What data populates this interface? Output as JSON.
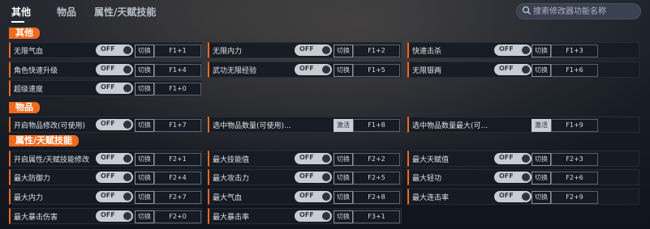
{
  "tabs": [
    "其他",
    "物品",
    "属性/天赋技能"
  ],
  "search": {
    "placeholder": "搜索修改器功能名称"
  },
  "sections": {
    "other": "其他",
    "items": "物品",
    "attrs": "属性/天赋技能"
  },
  "rows": [
    {
      "name": "无限气血",
      "toggle": "OFF",
      "action": "切换",
      "key": "F1+1"
    },
    {
      "name": "无限内力",
      "toggle": "OFF",
      "action": "切换",
      "key": "F1+2"
    },
    {
      "name": "快速击杀",
      "toggle": "OFF",
      "action": "切换",
      "key": "F1+3"
    },
    {
      "name": "角色快速升级",
      "toggle": "OFF",
      "action": "切换",
      "key": "F1+4"
    },
    {
      "name": "武功无限经验",
      "toggle": "OFF",
      "action": "切换",
      "key": "F1+5"
    },
    {
      "name": "无限银两",
      "toggle": "OFF",
      "action": "切换",
      "key": "F1+6"
    },
    {
      "name": "超级速度",
      "toggle": "OFF",
      "action": "切换",
      "key": "F1+0"
    },
    {
      "name": "开启物品修改(可使用)",
      "toggle": "OFF",
      "action": "切换",
      "key": "F1+7"
    },
    {
      "name": "选中物品数量(可使用)...",
      "toggle": "",
      "action": "激活",
      "key": "F1+8"
    },
    {
      "name": "选中物品数量最大(可...",
      "toggle": "",
      "action": "激活",
      "key": "F1+9"
    },
    {
      "name": "开启属性/天赋技能修改",
      "toggle": "OFF",
      "action": "切换",
      "key": "F2+1"
    },
    {
      "name": "最大技能值",
      "toggle": "OFF",
      "action": "切换",
      "key": "F2+2"
    },
    {
      "name": "最大天赋值",
      "toggle": "OFF",
      "action": "切换",
      "key": "F2+3"
    },
    {
      "name": "最大防御力",
      "toggle": "OFF",
      "action": "切换",
      "key": "F2+4"
    },
    {
      "name": "最大攻击力",
      "toggle": "OFF",
      "action": "切换",
      "key": "F2+5"
    },
    {
      "name": "最大轻功",
      "toggle": "OFF",
      "action": "切换",
      "key": "F2+6"
    },
    {
      "name": "最大内力",
      "toggle": "OFF",
      "action": "切换",
      "key": "F2+7"
    },
    {
      "name": "最大气血",
      "toggle": "OFF",
      "action": "切换",
      "key": "F2+8"
    },
    {
      "name": "最大连击率",
      "toggle": "OFF",
      "action": "切换",
      "key": "F2+9"
    },
    {
      "name": "最大暴击伤害",
      "toggle": "OFF",
      "action": "切换",
      "key": "F2+0"
    },
    {
      "name": "最大暴击率",
      "toggle": "OFF",
      "action": "切换",
      "key": "F3+1"
    }
  ],
  "colors": {
    "accent": "#f06a1d",
    "background": "#141a23"
  }
}
